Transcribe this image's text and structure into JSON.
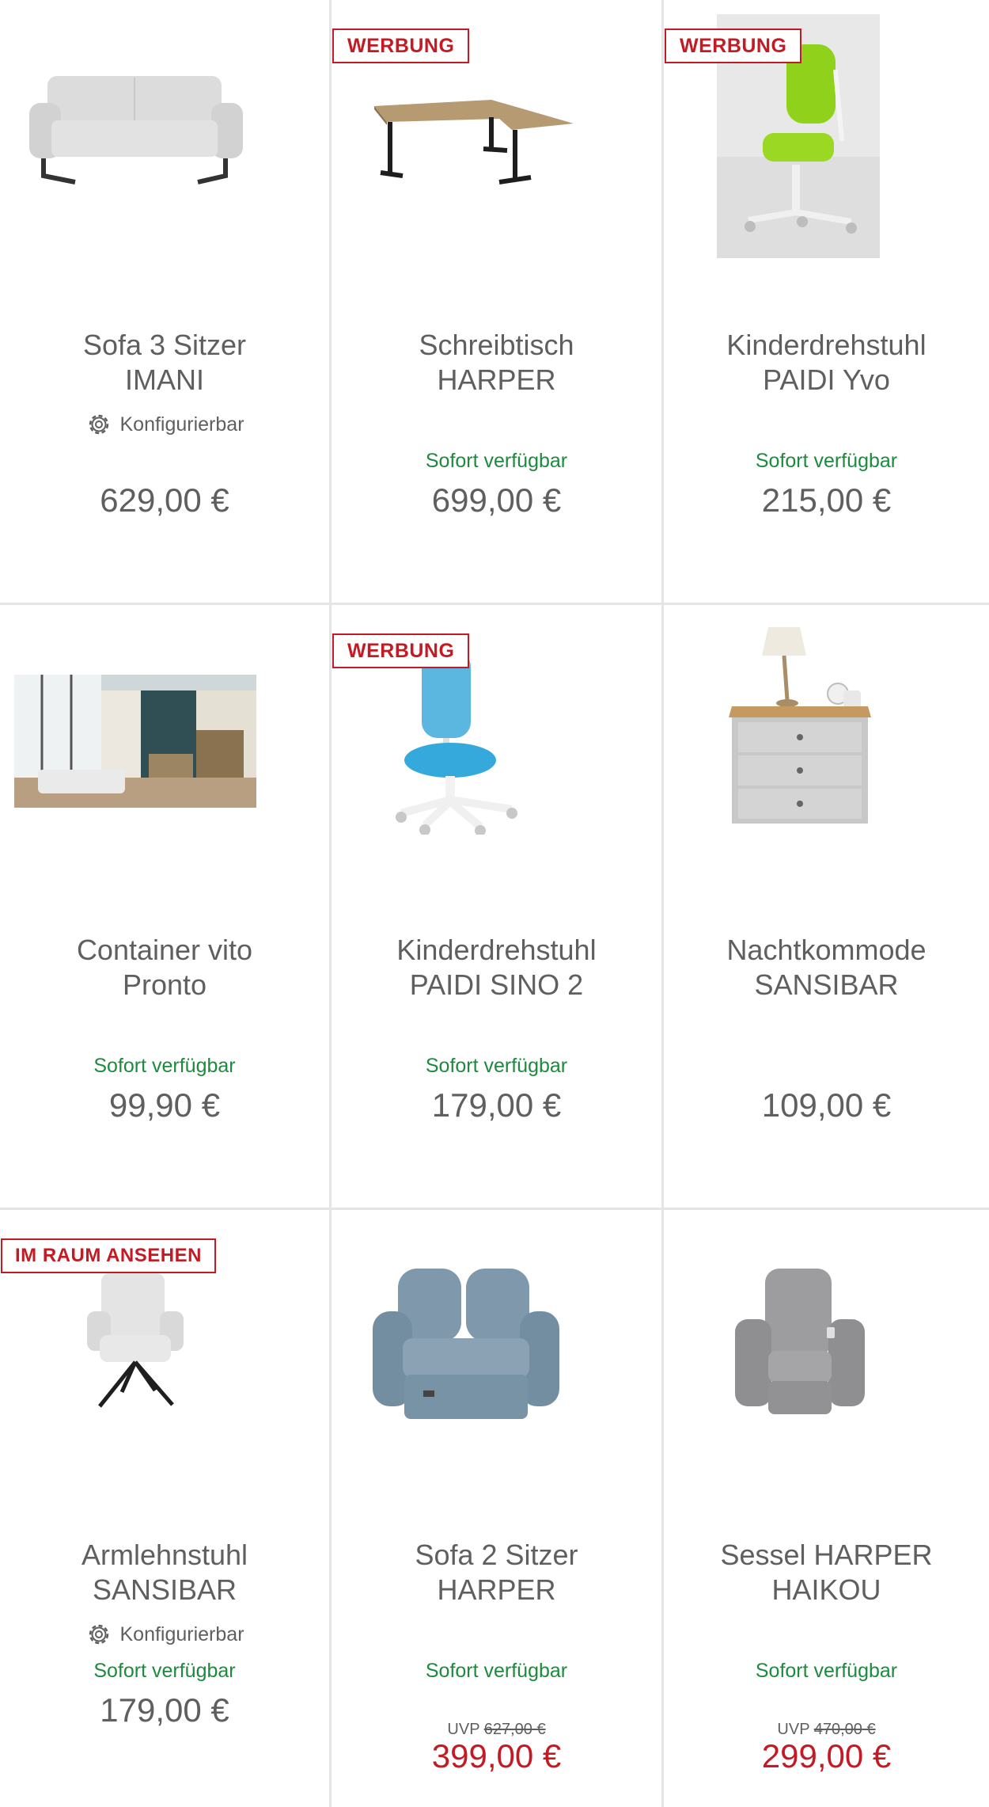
{
  "products": [
    {
      "name_line1": "Sofa 3 Sitzer",
      "name_line2": "IMANI",
      "badge": "",
      "configurable": "Konfigurierbar",
      "availability": "",
      "uvp_label": "",
      "uvp_price": "",
      "price": "629,00 €",
      "image_icon": "sofa-icon"
    },
    {
      "name_line1": "Schreibtisch",
      "name_line2": "HARPER",
      "badge": "WERBUNG",
      "configurable": "",
      "availability": "Sofort verfügbar",
      "uvp_label": "",
      "uvp_price": "",
      "price": "699,00 €",
      "image_icon": "desk-icon"
    },
    {
      "name_line1": "Kinderdrehstuhl",
      "name_line2": "PAIDI Yvo",
      "badge": "WERBUNG",
      "configurable": "",
      "availability": "Sofort verfügbar",
      "uvp_label": "",
      "uvp_price": "",
      "price": "215,00 €",
      "image_icon": "child-chair-icon"
    },
    {
      "name_line1": "Container vito",
      "name_line2": "Pronto",
      "badge": "",
      "configurable": "",
      "availability": "Sofort verfügbar",
      "uvp_label": "",
      "uvp_price": "",
      "price": "99,90 €",
      "image_icon": "room-scene-icon"
    },
    {
      "name_line1": "Kinderdrehstuhl",
      "name_line2": "PAIDI SINO 2",
      "badge": "WERBUNG",
      "configurable": "",
      "availability": "Sofort verfügbar",
      "uvp_label": "",
      "uvp_price": "",
      "price": "179,00 €",
      "image_icon": "child-chair-icon"
    },
    {
      "name_line1": "Nachtkommode",
      "name_line2": "SANSIBAR",
      "badge": "",
      "configurable": "",
      "availability": "",
      "uvp_label": "",
      "uvp_price": "",
      "price": "109,00 €",
      "image_icon": "nightstand-icon"
    },
    {
      "name_line1": "Armlehnstuhl",
      "name_line2": "SANSIBAR",
      "badge": "IM RAUM ANSEHEN",
      "configurable": "Konfigurierbar",
      "availability": "Sofort verfügbar",
      "uvp_label": "",
      "uvp_price": "",
      "price": "179,00 €",
      "image_icon": "armchair-icon"
    },
    {
      "name_line1": "Sofa 2 Sitzer",
      "name_line2": "HARPER",
      "badge": "",
      "configurable": "",
      "availability": "Sofort verfügbar",
      "uvp_label": "UVP",
      "uvp_price": "627,00 €",
      "price": "399,00 €",
      "image_icon": "recliner-sofa-icon"
    },
    {
      "name_line1": "Sessel HARPER",
      "name_line2": "HAIKOU",
      "badge": "",
      "configurable": "",
      "availability": "Sofort verfügbar",
      "uvp_label": "UVP",
      "uvp_price": "470,00 €",
      "price": "299,00 €",
      "image_icon": "recliner-chair-icon"
    }
  ],
  "colors": {
    "badge": "#c41a24",
    "availability": "#1d8b3d",
    "sale_price": "#c41a24",
    "text": "#5f5f5f",
    "divider": "#e4e4e4"
  }
}
